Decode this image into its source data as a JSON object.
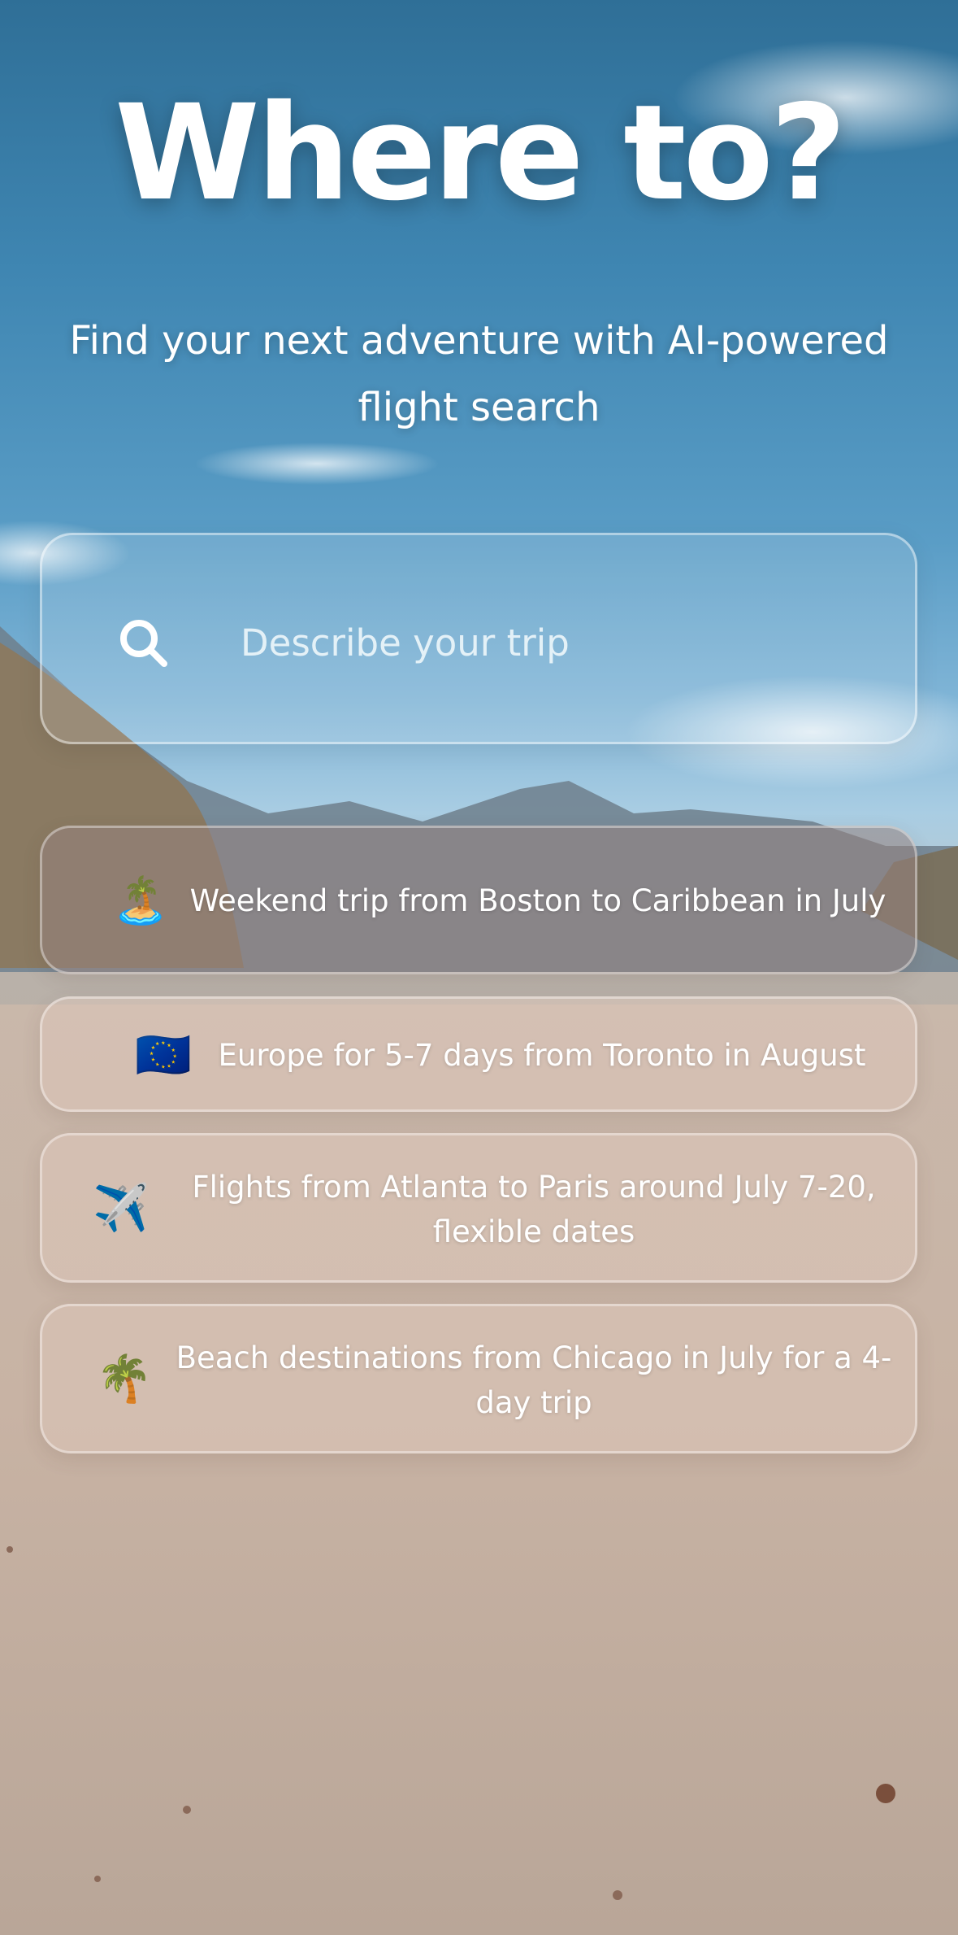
{
  "hero": {
    "title": "Where to?",
    "subtitle": "Find your next adventure with AI-powered flight search"
  },
  "search": {
    "placeholder": "Describe your trip",
    "icon": "search-icon"
  },
  "suggestions": [
    {
      "emoji": "🏝️",
      "icon": "desert-island-icon",
      "text": "Weekend trip from Boston to Caribbean in July"
    },
    {
      "emoji": "🇪🇺",
      "icon": "eu-flag-icon",
      "text": "Europe for 5-7 days from Toronto in August"
    },
    {
      "emoji": "✈️",
      "icon": "airplane-icon",
      "text": "Flights from Atlanta to Paris around July 7-20, flexible dates"
    },
    {
      "emoji": "🌴",
      "icon": "palm-tree-icon",
      "text": "Beach destinations from Chicago in July for a 4-day trip"
    }
  ],
  "colors": {
    "sky_top": "#2f6f97",
    "sky_mid": "#5a9dc6",
    "sand": "#c6b3a5",
    "text": "#ffffff"
  }
}
